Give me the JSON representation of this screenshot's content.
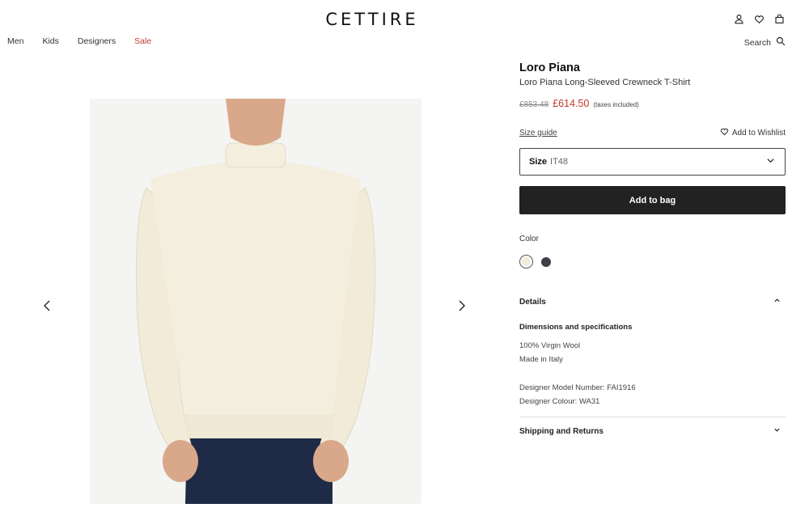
{
  "header": {
    "logo": "CETTIRE",
    "icons": [
      "account-icon",
      "heart-icon",
      "bag-icon"
    ]
  },
  "nav": {
    "items": [
      {
        "label": "Men"
      },
      {
        "label": "Kids"
      },
      {
        "label": "Designers"
      },
      {
        "label": "Sale",
        "color": "#c0392b"
      }
    ],
    "search_label": "Search"
  },
  "gallery": {
    "prev_icon": "chevron-left-icon",
    "next_icon": "chevron-right-icon"
  },
  "product": {
    "brand": "Loro Piana",
    "name": "Loro Piana Long-Sleeved Crewneck T-Shirt",
    "old_price": "£853.48",
    "new_price": "£614.50",
    "tax_note": "(taxes included)",
    "size_guide": "Size guide",
    "wishlist": "Add to Wishlist",
    "size_label": "Size",
    "size_value": "IT48",
    "add_to_bag": "Add to bag",
    "color_label": "Color",
    "swatches": [
      {
        "name": "cream",
        "hex": "#f2ecdc",
        "selected": true
      },
      {
        "name": "dark grey",
        "hex": "#3c3f44",
        "selected": false
      }
    ],
    "details": {
      "title": "Details",
      "subtitle": "Dimensions and specifications",
      "material": "100% Virgin Wool",
      "origin": "Made in Italy",
      "model_number": "Designer Model Number: FAI1916",
      "colour": "Designer Colour: WA31"
    },
    "shipping_title": "Shipping and Returns"
  },
  "colors": {
    "accent_sale": "#c0392b",
    "button_bg": "#222222"
  }
}
